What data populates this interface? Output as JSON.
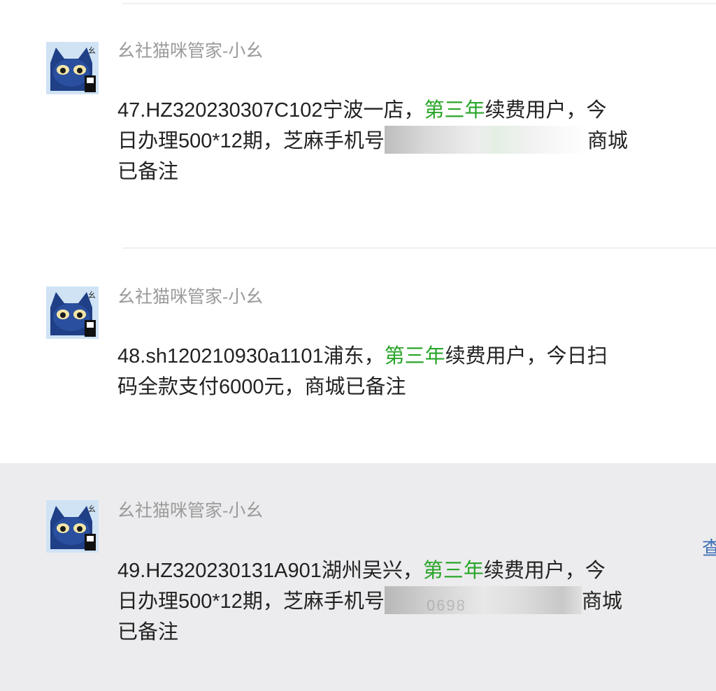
{
  "messages": [
    {
      "sender": "幺社猫咪管家-小幺",
      "lines": [
        [
          "47.HZ320230307C102宁波一店，",
          "第三年",
          "续费用户，今"
        ],
        [
          "日办理500*12期，芝麻手机号",
          "",
          "商城"
        ],
        [
          "已备注"
        ]
      ]
    },
    {
      "sender": "幺社猫咪管家-小幺",
      "lines": [
        [
          "48.sh120210930a1101浦东，",
          "第三年",
          "续费用户，今日扫"
        ],
        [
          "码全款支付6000元，商城已备注"
        ]
      ]
    },
    {
      "sender": "幺社猫咪管家-小幺",
      "lines": [
        [
          "49.HZ320230131A901湖州吴兴，",
          "第三年",
          "续费用户，今"
        ],
        [
          "日办理500*12期，芝麻手机号",
          "",
          "商城"
        ],
        [
          "已备注"
        ]
      ],
      "redacted_hint": "0698"
    }
  ],
  "side_link": "查",
  "colors": {
    "highlight_green": "#2aa52a",
    "sender_gray": "#9b9b9b",
    "selected_bg": "#ececee",
    "avatar_blue": "#1f3f86"
  },
  "icons": {
    "avatar": "cat-avatar-icon"
  }
}
